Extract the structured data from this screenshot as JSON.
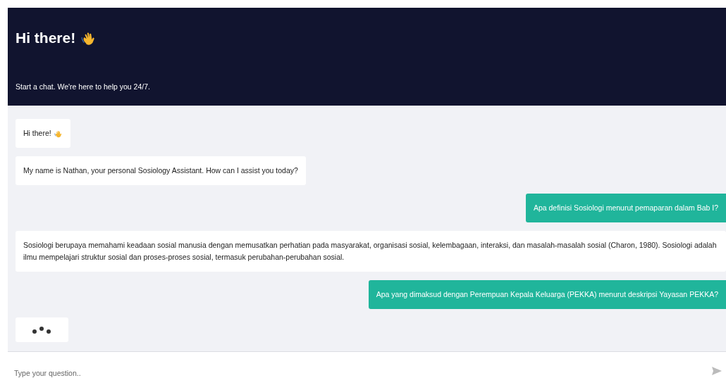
{
  "header": {
    "title": "Hi there!",
    "subtitle": "Start a chat. We're here to help you 24/7."
  },
  "messages": [
    {
      "kind": "bot",
      "text": "Hi there!",
      "wave": true
    },
    {
      "kind": "bot",
      "text": "My name is Nathan, your personal Sosiology Assistant. How can I assist you today?"
    },
    {
      "kind": "user",
      "text": "Apa definisi Sosiologi menurut pemaparan dalam Bab I?"
    },
    {
      "kind": "bot",
      "text": "Sosiologi berupaya memahami keadaan sosial manusia dengan memusatkan perhatian pada masyarakat, organisasi sosial, kelembagaan, interaksi, dan masalah-masalah sosial (Charon, 1980). Sosiologi adalah ilmu mempelajari struktur sosial dan proses-proses sosial, termasuk perubahan-perubahan sosial."
    },
    {
      "kind": "user",
      "text": "Apa yang dimaksud dengan Perempuan Kepala Keluarga (PEKKA) menurut deskripsi Yayasan PEKKA?"
    },
    {
      "kind": "typing"
    }
  ],
  "composer": {
    "placeholder": "Type your question.."
  }
}
